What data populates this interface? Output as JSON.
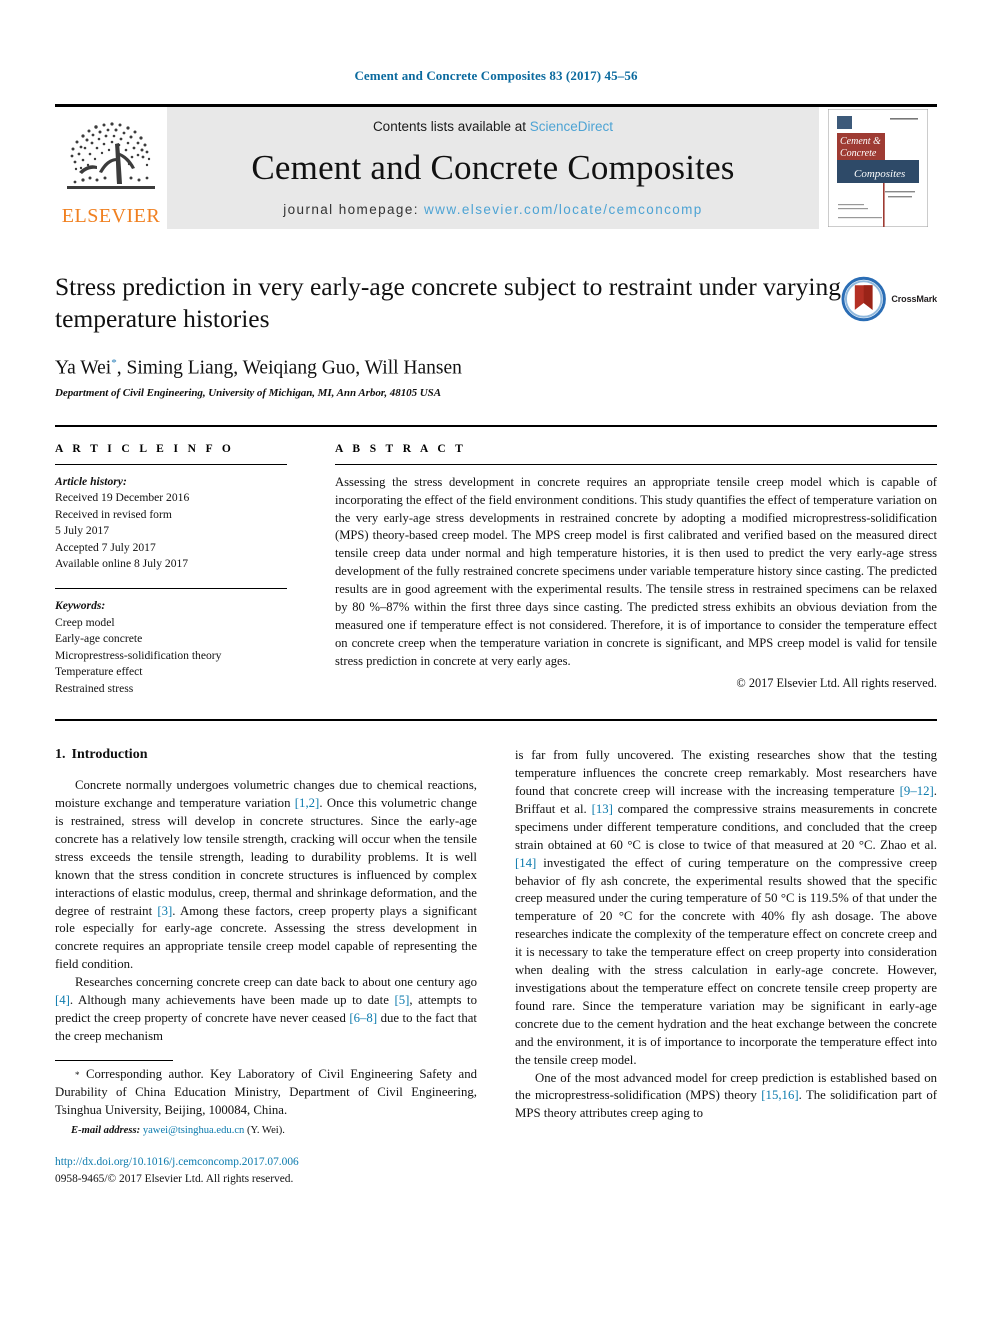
{
  "running_head": "Cement and Concrete Composites 83 (2017) 45–56",
  "masthead": {
    "contents_prefix": "Contents lists available at ",
    "sciencedirect": "ScienceDirect",
    "journal_title": "Cement and Concrete Composites",
    "homepage_prefix": "journal homepage: ",
    "homepage_url": "www.elsevier.com/locate/cemconcomp",
    "publisher_wordmark": "ELSEVIER",
    "cover_line1": "Cement &",
    "cover_line2": "Concrete",
    "cover_line3": "Composites",
    "colors": {
      "link_blue": "#4da3d4",
      "elsevier_orange": "#f08020",
      "band_gray": "#e8e8e8"
    }
  },
  "article": {
    "title": "Stress prediction in very early-age concrete subject to restraint under varying temperature histories",
    "authors": "Ya Wei",
    "authors_rest": ", Siming Liang, Weiqiang Guo, Will Hansen",
    "corresponding_marker": "*",
    "affiliation": "Department of Civil Engineering, University of Michigan, MI, Ann Arbor, 48105 USA",
    "crossmark_label": "CrossMark"
  },
  "article_info": {
    "heading": "A R T I C L E   I N F O",
    "history_label": "Article history:",
    "history": [
      "Received 19 December 2016",
      "Received in revised form",
      "5 July 2017",
      "Accepted 7 July 2017",
      "Available online 8 July 2017"
    ],
    "keywords_label": "Keywords:",
    "keywords": [
      "Creep model",
      "Early-age concrete",
      "Microprestress-solidification theory",
      "Temperature effect",
      "Restrained stress"
    ]
  },
  "abstract": {
    "heading": "A B S T R A C T",
    "text": "Assessing the stress development in concrete requires an appropriate tensile creep model which is capable of incorporating the effect of the field environment conditions. This study quantifies the effect of temperature variation on the very early-age stress developments in restrained concrete by adopting a modified microprestress-solidification (MPS) theory-based creep model. The MPS creep model is first calibrated and verified based on the measured direct tensile creep data under normal and high temperature histories, it is then used to predict the very early-age stress development of the fully restrained concrete specimens under variable temperature history since casting. The predicted results are in good agreement with the experimental results. The tensile stress in restrained specimens can be relaxed by 80 %–87% within the first three days since casting. The predicted stress exhibits an obvious deviation from the measured one if temperature effect is not considered. Therefore, it is of importance to consider the temperature effect on concrete creep when the temperature variation in concrete is significant, and MPS creep model is valid for tensile stress prediction in concrete at very early ages.",
    "copyright": "© 2017 Elsevier Ltd. All rights reserved."
  },
  "introduction": {
    "number": "1.",
    "heading": "Introduction",
    "left_para_1_a": "Concrete normally undergoes volumetric changes due to chemical reactions, moisture exchange and temperature variation ",
    "left_para_1_ref1": "[1,2]",
    "left_para_1_b": ". Once this volumetric change is restrained, stress will develop in concrete structures. Since the early-age concrete has a relatively low tensile strength, cracking will occur when the tensile stress exceeds the tensile strength, leading to durability problems. It is well known that the stress condition in concrete structures is influenced by complex interactions of elastic modulus, creep, thermal and shrinkage deformation, and the degree of restraint ",
    "left_para_1_ref2": "[3]",
    "left_para_1_c": ". Among these factors, creep property plays a significant role especially for early-age concrete. Assessing the stress development in concrete requires an appropriate tensile creep model capable of representing the field condition.",
    "left_para_2_a": "Researches concerning concrete creep can date back to about one century ago ",
    "left_para_2_ref1": "[4]",
    "left_para_2_b": ". Although many achievements have been made up to date ",
    "left_para_2_ref2": "[5]",
    "left_para_2_c": ", attempts to predict the creep property of concrete have never ceased ",
    "left_para_2_ref3": "[6–8]",
    "left_para_2_d": " due to the fact that the creep mechanism",
    "right_para_1_a": "is far from fully uncovered. The existing researches show that the testing temperature influences the concrete creep remarkably. Most researchers have found that concrete creep will increase with the increasing temperature ",
    "right_para_1_ref1": "[9–12]",
    "right_para_1_b": ". Briffaut et al. ",
    "right_para_1_ref2": "[13]",
    "right_para_1_c": " compared the compressive strains measurements in concrete specimens under different temperature conditions, and concluded that the creep strain obtained at 60 °C is close to twice of that measured at 20 °C. Zhao et al. ",
    "right_para_1_ref3": "[14]",
    "right_para_1_d": " investigated the effect of curing temperature on the compressive creep behavior of fly ash concrete, the experimental results showed that the specific creep measured under the curing temperature of 50 °C is 119.5% of that under the temperature of 20 °C for the concrete with 40% fly ash dosage. The above researches indicate the complexity of the temperature effect on concrete creep and it is necessary to take the temperature effect on creep property into consideration when dealing with the stress calculation in early-age concrete. However, investigations about the temperature effect on concrete tensile creep property are found rare. Since the temperature variation may be significant in early-age concrete due to the cement hydration and the heat exchange between the concrete and the environment, it is of importance to incorporate the temperature effect into the tensile creep model.",
    "right_para_2_a": "One of the most advanced model for creep prediction is established based on the microprestress-solidification (MPS) theory ",
    "right_para_2_ref1": "[15,16]",
    "right_para_2_b": ". The solidification part of MPS theory attributes creep aging to"
  },
  "footnote": {
    "star": "*",
    "text": " Corresponding author. Key Laboratory of Civil Engineering Safety and Durability of China Education Ministry, Department of Civil Engineering, Tsinghua University, Beijing, 100084, China.",
    "email_label": "E-mail address:",
    "email_address": "yawei@tsinghua.edu.cn",
    "email_suffix": " (Y. Wei)."
  },
  "publication_footer": {
    "doi": "http://dx.doi.org/10.1016/j.cemconcomp.2017.07.006",
    "issn_line": "0958-9465/© 2017 Elsevier Ltd. All rights reserved."
  }
}
